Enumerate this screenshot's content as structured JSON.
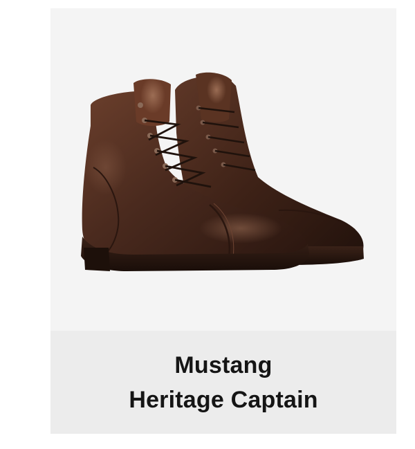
{
  "product": {
    "image_icon": "boot-product-image",
    "name_line_1": "Mustang",
    "name_line_2": "Heritage Captain",
    "colors": {
      "card_background": "#f4f4f4",
      "caption_background": "#ececec",
      "text": "#151515",
      "leather": "#4a2a1e"
    }
  }
}
